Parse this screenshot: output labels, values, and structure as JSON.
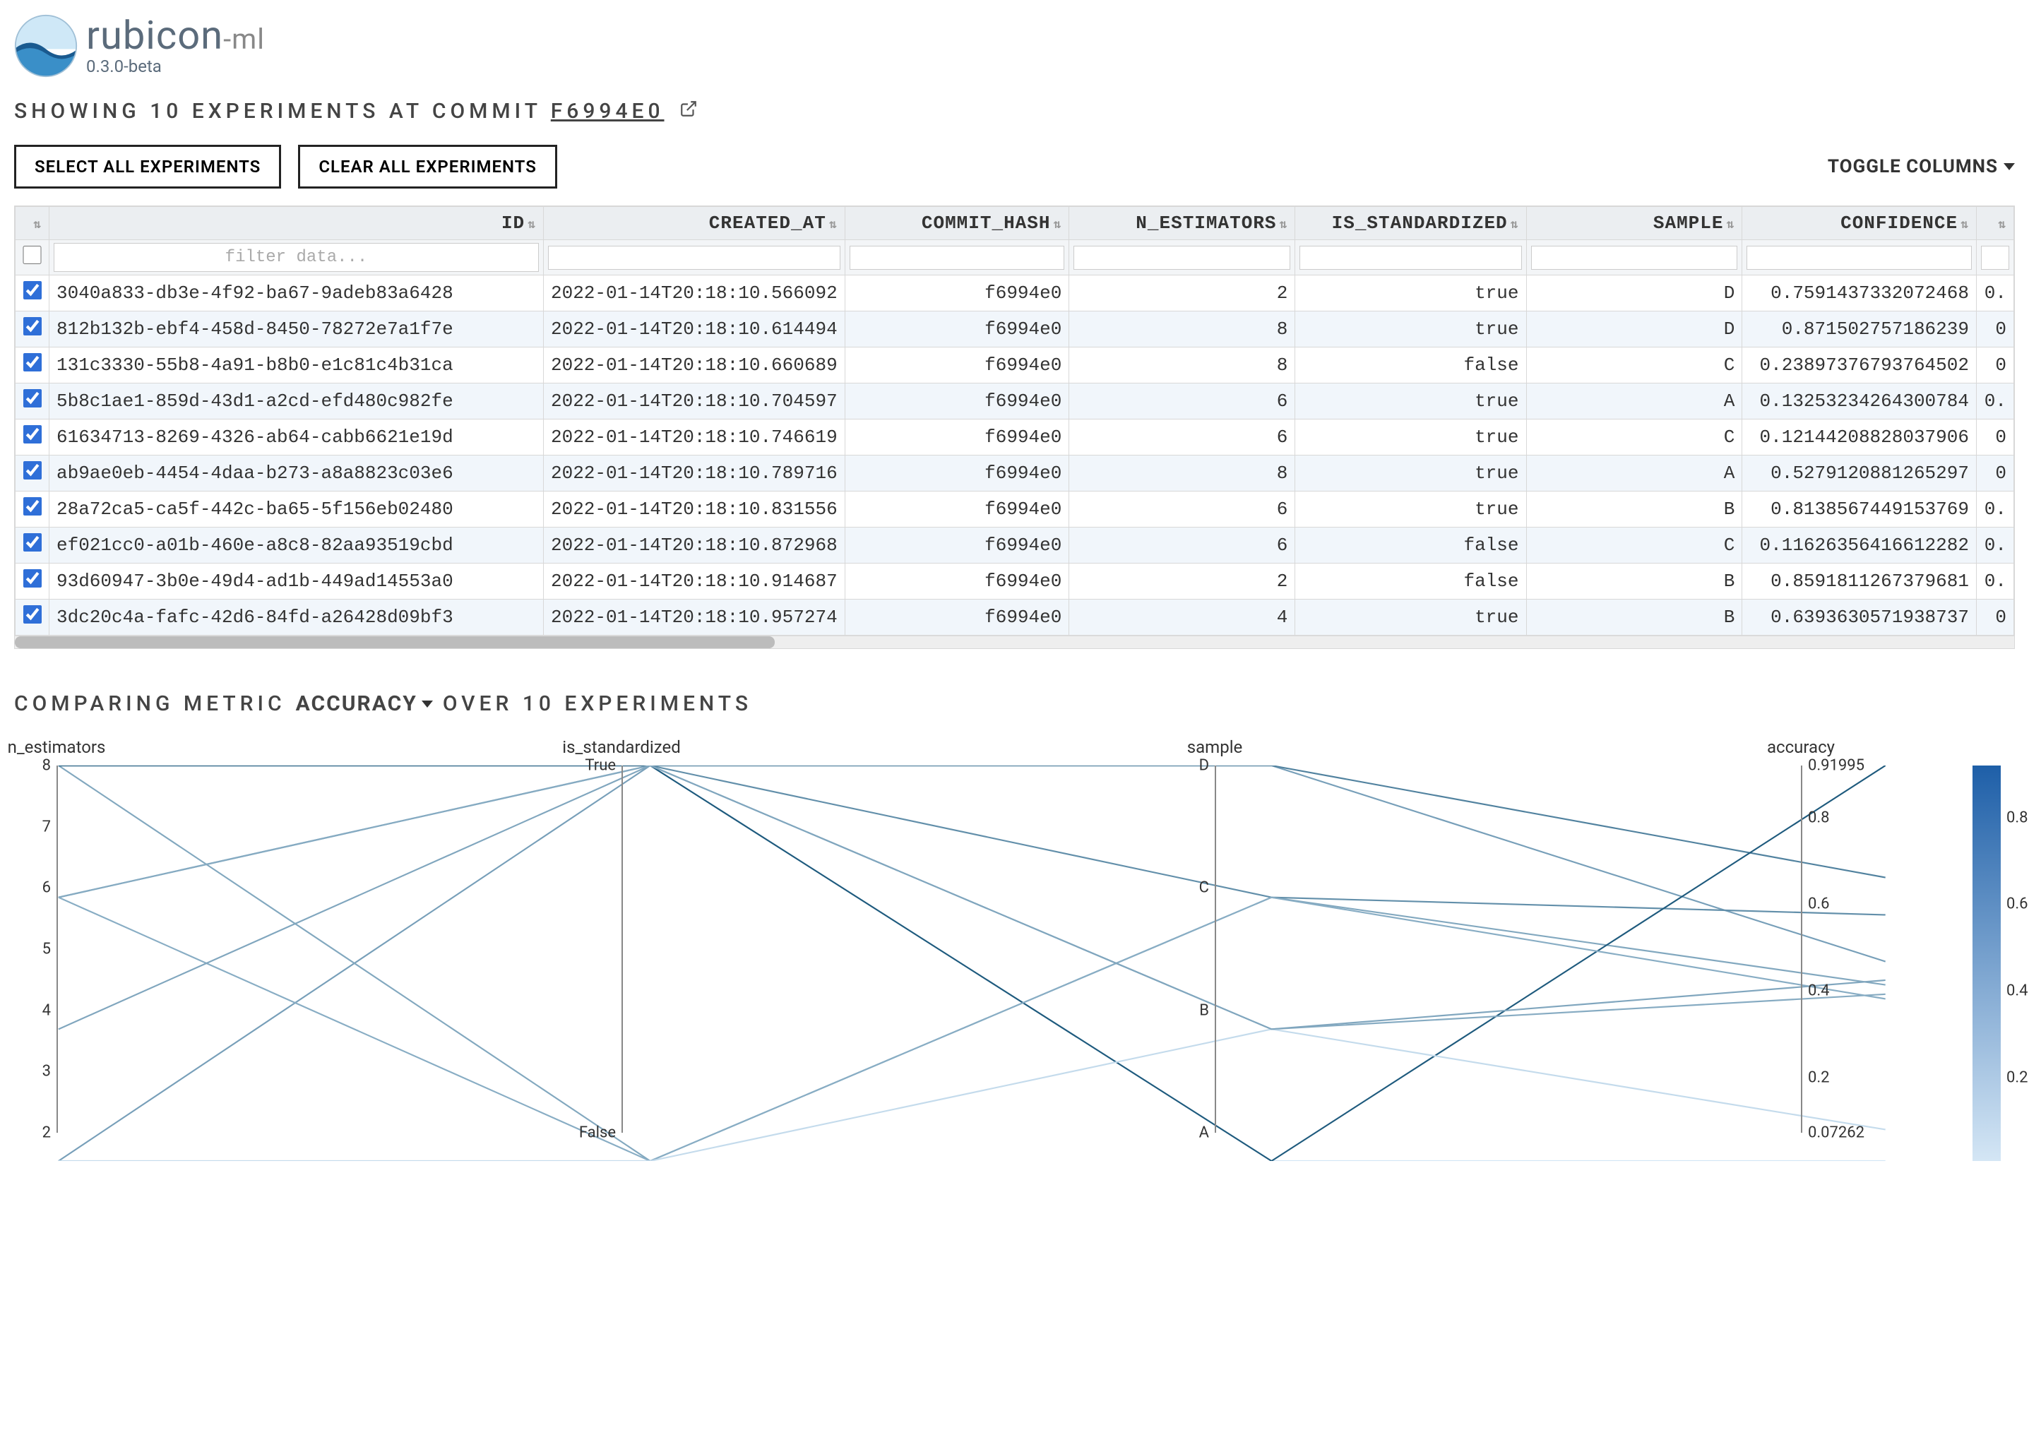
{
  "logo": {
    "main": "rubicon",
    "suffix": "-ml",
    "version": "0.3.0-beta"
  },
  "subtitle": {
    "prefix": "SHOWING 10 EXPERIMENTS AT COMMIT",
    "commit": "F6994E0"
  },
  "buttons": {
    "select_all": "SELECT ALL EXPERIMENTS",
    "clear_all": "CLEAR ALL EXPERIMENTS",
    "toggle_columns": "TOGGLE COLUMNS"
  },
  "table": {
    "headers": [
      "",
      "ID",
      "CREATED_AT",
      "COMMIT_HASH",
      "N_ESTIMATORS",
      "IS_STANDARDIZED",
      "SAMPLE",
      "CONFIDENCE",
      ""
    ],
    "filter_placeholder": "filter data...",
    "rows": [
      {
        "id": "3040a833-db3e-4f92-ba67-9adeb83a6428",
        "created_at": "2022-01-14T20:18:10.566092",
        "commit": "f6994e0",
        "n_est": "2",
        "std": "true",
        "sample": "D",
        "conf": "0.7591437332072468",
        "tail": "0."
      },
      {
        "id": "812b132b-ebf4-458d-8450-78272e7a1f7e",
        "created_at": "2022-01-14T20:18:10.614494",
        "commit": "f6994e0",
        "n_est": "8",
        "std": "true",
        "sample": "D",
        "conf": "0.871502757186239",
        "tail": "0"
      },
      {
        "id": "131c3330-55b8-4a91-b8b0-e1c81c4b31ca",
        "created_at": "2022-01-14T20:18:10.660689",
        "commit": "f6994e0",
        "n_est": "8",
        "std": "false",
        "sample": "C",
        "conf": "0.23897376793764502",
        "tail": "0"
      },
      {
        "id": "5b8c1ae1-859d-43d1-a2cd-efd480c982fe",
        "created_at": "2022-01-14T20:18:10.704597",
        "commit": "f6994e0",
        "n_est": "6",
        "std": "true",
        "sample": "A",
        "conf": "0.13253234264300784",
        "tail": "0."
      },
      {
        "id": "61634713-8269-4326-ab64-cabb6621e19d",
        "created_at": "2022-01-14T20:18:10.746619",
        "commit": "f6994e0",
        "n_est": "6",
        "std": "true",
        "sample": "C",
        "conf": "0.12144208828037906",
        "tail": "0"
      },
      {
        "id": "ab9ae0eb-4454-4daa-b273-a8a8823c03e6",
        "created_at": "2022-01-14T20:18:10.789716",
        "commit": "f6994e0",
        "n_est": "8",
        "std": "true",
        "sample": "A",
        "conf": "0.5279120881265297",
        "tail": "0"
      },
      {
        "id": "28a72ca5-ca5f-442c-ba65-5f156eb02480",
        "created_at": "2022-01-14T20:18:10.831556",
        "commit": "f6994e0",
        "n_est": "6",
        "std": "true",
        "sample": "B",
        "conf": "0.8138567449153769",
        "tail": "0."
      },
      {
        "id": "ef021cc0-a01b-460e-a8c8-82aa93519cbd",
        "created_at": "2022-01-14T20:18:10.872968",
        "commit": "f6994e0",
        "n_est": "6",
        "std": "false",
        "sample": "C",
        "conf": "0.11626356416612282",
        "tail": "0."
      },
      {
        "id": "93d60947-3b0e-49d4-ad1b-449ad14553a0",
        "created_at": "2022-01-14T20:18:10.914687",
        "commit": "f6994e0",
        "n_est": "2",
        "std": "false",
        "sample": "B",
        "conf": "0.8591811267379681",
        "tail": "0."
      },
      {
        "id": "3dc20c4a-fafc-42d6-84fd-a26428d09bf3",
        "created_at": "2022-01-14T20:18:10.957274",
        "commit": "f6994e0",
        "n_est": "4",
        "std": "true",
        "sample": "B",
        "conf": "0.6393630571938737",
        "tail": "0"
      }
    ]
  },
  "compare": {
    "prefix": "COMPARING METRIC",
    "metric": "ACCURACY",
    "suffix": "OVER 10 EXPERIMENTS"
  },
  "chart_data": {
    "type": "parallel-coordinates",
    "axes": [
      {
        "name": "n_estimators",
        "ticks": [
          "8",
          "7",
          "6",
          "5",
          "4",
          "3",
          "2"
        ],
        "range": [
          2,
          8
        ]
      },
      {
        "name": "is_standardized",
        "ticks": [
          "True",
          "False"
        ],
        "categorical": true
      },
      {
        "name": "sample",
        "ticks": [
          "D",
          "C",
          "B",
          "A"
        ],
        "categorical": true
      },
      {
        "name": "accuracy",
        "ticks": [
          "0.91995",
          "0.8",
          "0.6",
          "0.4",
          "0.2",
          "0.07262"
        ],
        "range": [
          0.07262,
          0.91995
        ]
      }
    ],
    "colorbar": {
      "ticks": [
        "0.8",
        "0.6",
        "0.4",
        "0.2"
      ]
    },
    "series": [
      {
        "n_estimators": 2,
        "is_standardized": "True",
        "sample": "D",
        "accuracy": 0.5
      },
      {
        "n_estimators": 8,
        "is_standardized": "True",
        "sample": "D",
        "accuracy": 0.68
      },
      {
        "n_estimators": 8,
        "is_standardized": "False",
        "sample": "C",
        "accuracy": 0.45
      },
      {
        "n_estimators": 6,
        "is_standardized": "True",
        "sample": "A",
        "accuracy": 0.07262
      },
      {
        "n_estimators": 6,
        "is_standardized": "True",
        "sample": "C",
        "accuracy": 0.6
      },
      {
        "n_estimators": 8,
        "is_standardized": "True",
        "sample": "A",
        "accuracy": 0.91995
      },
      {
        "n_estimators": 6,
        "is_standardized": "True",
        "sample": "B",
        "accuracy": 0.43
      },
      {
        "n_estimators": 6,
        "is_standardized": "False",
        "sample": "C",
        "accuracy": 0.42
      },
      {
        "n_estimators": 2,
        "is_standardized": "False",
        "sample": "B",
        "accuracy": 0.14
      },
      {
        "n_estimators": 4,
        "is_standardized": "True",
        "sample": "B",
        "accuracy": 0.46
      }
    ]
  }
}
